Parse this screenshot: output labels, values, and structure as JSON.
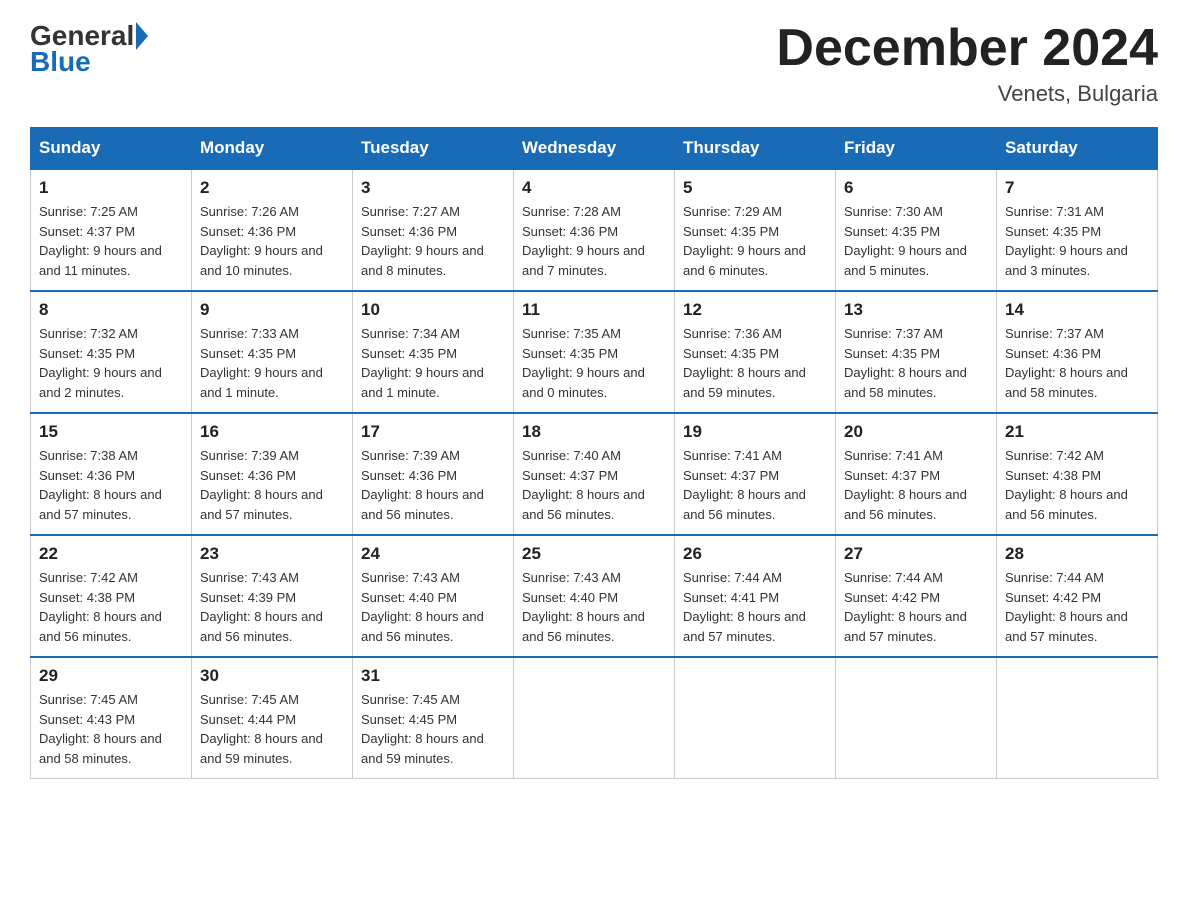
{
  "logo": {
    "general": "General",
    "blue": "Blue"
  },
  "header": {
    "month_year": "December 2024",
    "location": "Venets, Bulgaria"
  },
  "days_of_week": [
    "Sunday",
    "Monday",
    "Tuesday",
    "Wednesday",
    "Thursday",
    "Friday",
    "Saturday"
  ],
  "weeks": [
    [
      {
        "day": "1",
        "sunrise": "7:25 AM",
        "sunset": "4:37 PM",
        "daylight": "9 hours and 11 minutes."
      },
      {
        "day": "2",
        "sunrise": "7:26 AM",
        "sunset": "4:36 PM",
        "daylight": "9 hours and 10 minutes."
      },
      {
        "day": "3",
        "sunrise": "7:27 AM",
        "sunset": "4:36 PM",
        "daylight": "9 hours and 8 minutes."
      },
      {
        "day": "4",
        "sunrise": "7:28 AM",
        "sunset": "4:36 PM",
        "daylight": "9 hours and 7 minutes."
      },
      {
        "day": "5",
        "sunrise": "7:29 AM",
        "sunset": "4:35 PM",
        "daylight": "9 hours and 6 minutes."
      },
      {
        "day": "6",
        "sunrise": "7:30 AM",
        "sunset": "4:35 PM",
        "daylight": "9 hours and 5 minutes."
      },
      {
        "day": "7",
        "sunrise": "7:31 AM",
        "sunset": "4:35 PM",
        "daylight": "9 hours and 3 minutes."
      }
    ],
    [
      {
        "day": "8",
        "sunrise": "7:32 AM",
        "sunset": "4:35 PM",
        "daylight": "9 hours and 2 minutes."
      },
      {
        "day": "9",
        "sunrise": "7:33 AM",
        "sunset": "4:35 PM",
        "daylight": "9 hours and 1 minute."
      },
      {
        "day": "10",
        "sunrise": "7:34 AM",
        "sunset": "4:35 PM",
        "daylight": "9 hours and 1 minute."
      },
      {
        "day": "11",
        "sunrise": "7:35 AM",
        "sunset": "4:35 PM",
        "daylight": "9 hours and 0 minutes."
      },
      {
        "day": "12",
        "sunrise": "7:36 AM",
        "sunset": "4:35 PM",
        "daylight": "8 hours and 59 minutes."
      },
      {
        "day": "13",
        "sunrise": "7:37 AM",
        "sunset": "4:35 PM",
        "daylight": "8 hours and 58 minutes."
      },
      {
        "day": "14",
        "sunrise": "7:37 AM",
        "sunset": "4:36 PM",
        "daylight": "8 hours and 58 minutes."
      }
    ],
    [
      {
        "day": "15",
        "sunrise": "7:38 AM",
        "sunset": "4:36 PM",
        "daylight": "8 hours and 57 minutes."
      },
      {
        "day": "16",
        "sunrise": "7:39 AM",
        "sunset": "4:36 PM",
        "daylight": "8 hours and 57 minutes."
      },
      {
        "day": "17",
        "sunrise": "7:39 AM",
        "sunset": "4:36 PM",
        "daylight": "8 hours and 56 minutes."
      },
      {
        "day": "18",
        "sunrise": "7:40 AM",
        "sunset": "4:37 PM",
        "daylight": "8 hours and 56 minutes."
      },
      {
        "day": "19",
        "sunrise": "7:41 AM",
        "sunset": "4:37 PM",
        "daylight": "8 hours and 56 minutes."
      },
      {
        "day": "20",
        "sunrise": "7:41 AM",
        "sunset": "4:37 PM",
        "daylight": "8 hours and 56 minutes."
      },
      {
        "day": "21",
        "sunrise": "7:42 AM",
        "sunset": "4:38 PM",
        "daylight": "8 hours and 56 minutes."
      }
    ],
    [
      {
        "day": "22",
        "sunrise": "7:42 AM",
        "sunset": "4:38 PM",
        "daylight": "8 hours and 56 minutes."
      },
      {
        "day": "23",
        "sunrise": "7:43 AM",
        "sunset": "4:39 PM",
        "daylight": "8 hours and 56 minutes."
      },
      {
        "day": "24",
        "sunrise": "7:43 AM",
        "sunset": "4:40 PM",
        "daylight": "8 hours and 56 minutes."
      },
      {
        "day": "25",
        "sunrise": "7:43 AM",
        "sunset": "4:40 PM",
        "daylight": "8 hours and 56 minutes."
      },
      {
        "day": "26",
        "sunrise": "7:44 AM",
        "sunset": "4:41 PM",
        "daylight": "8 hours and 57 minutes."
      },
      {
        "day": "27",
        "sunrise": "7:44 AM",
        "sunset": "4:42 PM",
        "daylight": "8 hours and 57 minutes."
      },
      {
        "day": "28",
        "sunrise": "7:44 AM",
        "sunset": "4:42 PM",
        "daylight": "8 hours and 57 minutes."
      }
    ],
    [
      {
        "day": "29",
        "sunrise": "7:45 AM",
        "sunset": "4:43 PM",
        "daylight": "8 hours and 58 minutes."
      },
      {
        "day": "30",
        "sunrise": "7:45 AM",
        "sunset": "4:44 PM",
        "daylight": "8 hours and 59 minutes."
      },
      {
        "day": "31",
        "sunrise": "7:45 AM",
        "sunset": "4:45 PM",
        "daylight": "8 hours and 59 minutes."
      },
      null,
      null,
      null,
      null
    ]
  ],
  "labels": {
    "sunrise": "Sunrise:",
    "sunset": "Sunset:",
    "daylight": "Daylight:"
  }
}
